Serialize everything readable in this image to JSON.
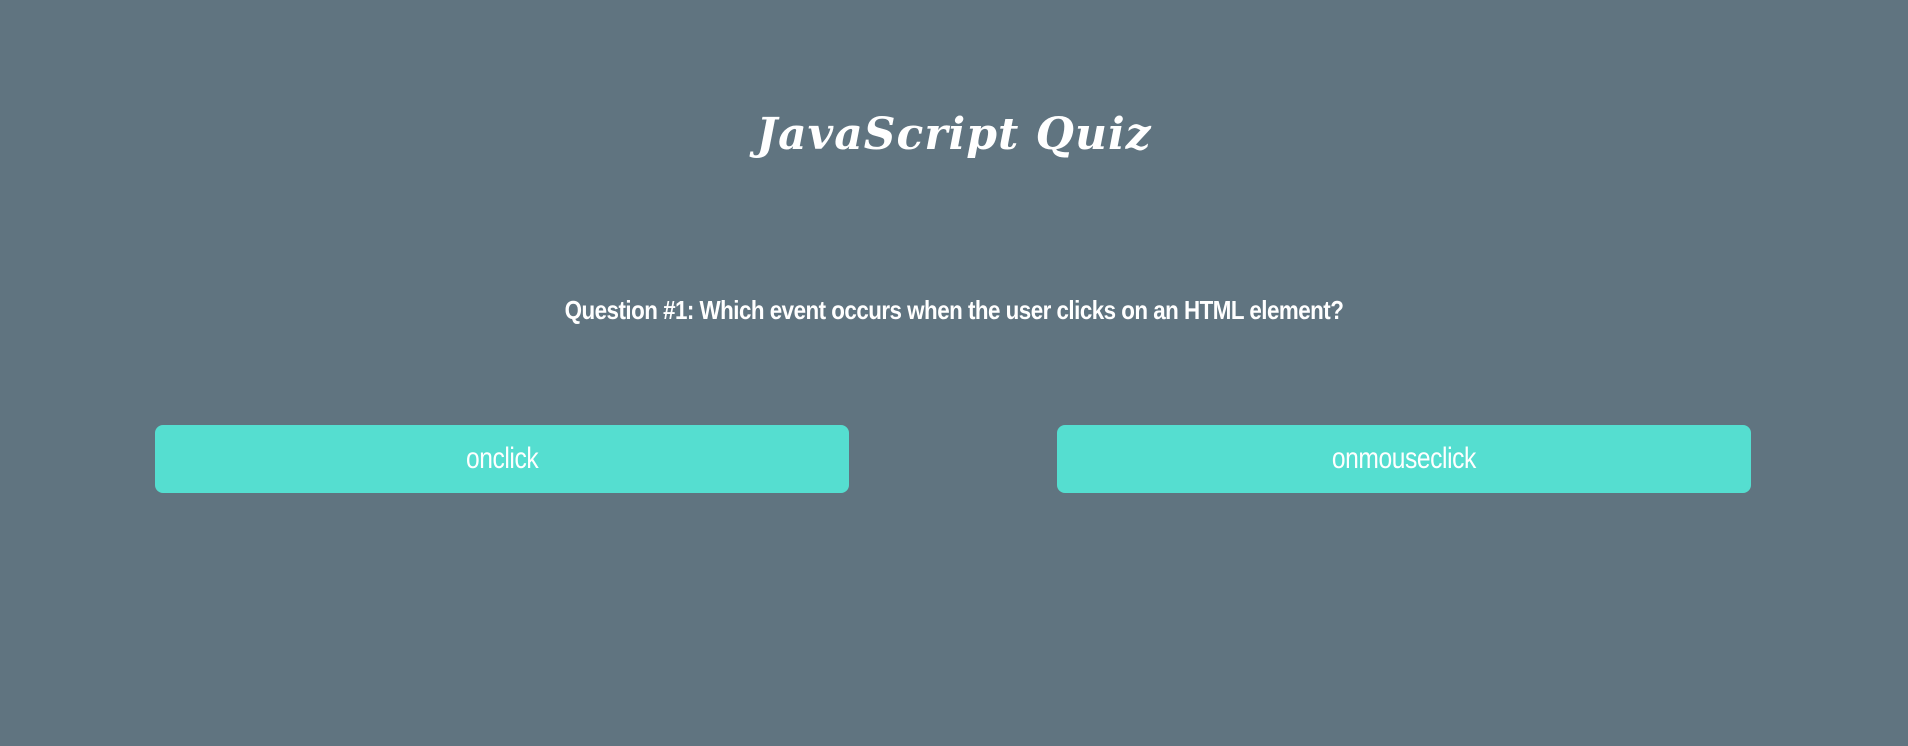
{
  "quiz": {
    "title": "JavaScript Quiz",
    "question": "Question #1: Which event occurs when the user clicks on an HTML element?",
    "answers": [
      {
        "label": "onclick"
      },
      {
        "label": "onmouseclick"
      }
    ]
  },
  "colors": {
    "background": "#607480",
    "button": "#55ded0",
    "text": "#ffffff"
  }
}
